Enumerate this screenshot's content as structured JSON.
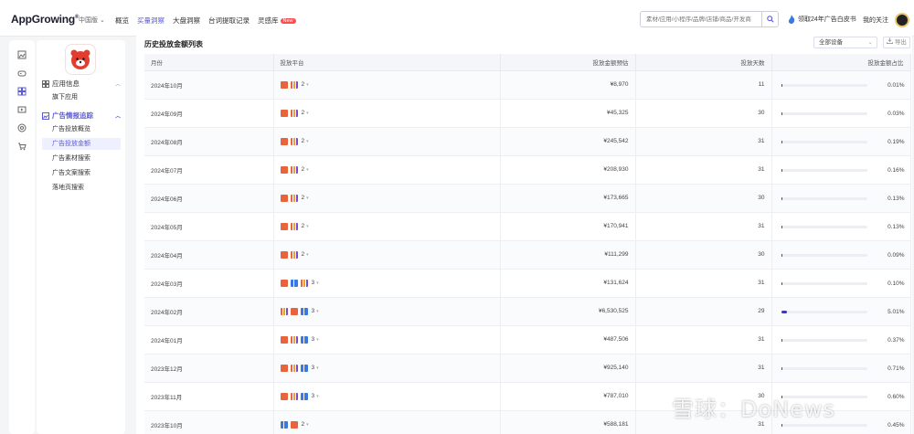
{
  "header": {
    "logo": "AppGrowing",
    "region": "中国版",
    "nav": [
      {
        "label": "概览",
        "active": false
      },
      {
        "label": "买量洞察",
        "active": true
      },
      {
        "label": "大盘洞察",
        "active": false
      },
      {
        "label": "台词提取记录",
        "active": false
      },
      {
        "label": "灵感库",
        "active": false,
        "badge": "New"
      }
    ],
    "search_placeholder": "素材/应用/小程序/品牌/店铺/商品/开发商",
    "promo": "领取24年广告白皮书",
    "follow": "我的关注"
  },
  "sidebar": {
    "section1": "应用信息",
    "section1_items": [
      "旗下应用"
    ],
    "section2": "广告情报追踪",
    "section2_items": [
      {
        "label": "广告投放概览",
        "active": false
      },
      {
        "label": "广告投放金额",
        "active": true
      },
      {
        "label": "广告素材搜索",
        "active": false
      },
      {
        "label": "广告文案搜索",
        "active": false
      },
      {
        "label": "落地页搜索",
        "active": false
      }
    ]
  },
  "main": {
    "title": "历史投放金额列表",
    "filter": "全部设备",
    "export": "导出",
    "columns": [
      "月份",
      "投放平台",
      "投放金额预估",
      "投放天数",
      "投放金额占比"
    ],
    "rows": [
      {
        "month": "2024年10月",
        "icons": [
          "toutiao",
          "multi"
        ],
        "platforms": "2",
        "amount": "¥8,970",
        "days": "11",
        "share": "0.01%",
        "share_pct": 0.01
      },
      {
        "month": "2024年09月",
        "icons": [
          "toutiao",
          "multi"
        ],
        "platforms": "2",
        "amount": "¥45,325",
        "days": "30",
        "share": "0.03%",
        "share_pct": 0.03
      },
      {
        "month": "2024年08月",
        "icons": [
          "toutiao",
          "multi"
        ],
        "platforms": "2",
        "amount": "¥245,542",
        "days": "31",
        "share": "0.19%",
        "share_pct": 0.19
      },
      {
        "month": "2024年07月",
        "icons": [
          "toutiao",
          "multi"
        ],
        "platforms": "2",
        "amount": "¥208,930",
        "days": "31",
        "share": "0.16%",
        "share_pct": 0.16
      },
      {
        "month": "2024年06月",
        "icons": [
          "toutiao",
          "multi"
        ],
        "platforms": "2",
        "amount": "¥173,665",
        "days": "30",
        "share": "0.13%",
        "share_pct": 0.13
      },
      {
        "month": "2024年05月",
        "icons": [
          "toutiao",
          "multi"
        ],
        "platforms": "2",
        "amount": "¥170,941",
        "days": "31",
        "share": "0.13%",
        "share_pct": 0.13
      },
      {
        "month": "2024年04月",
        "icons": [
          "toutiao",
          "multi"
        ],
        "platforms": "2",
        "amount": "¥111,299",
        "days": "30",
        "share": "0.09%",
        "share_pct": 0.09
      },
      {
        "month": "2024年03月",
        "icons": [
          "toutiao",
          "blue",
          "multi"
        ],
        "platforms": "3",
        "amount": "¥131,624",
        "days": "31",
        "share": "0.10%",
        "share_pct": 0.1
      },
      {
        "month": "2024年02月",
        "icons": [
          "multi",
          "toutiao",
          "blue"
        ],
        "platforms": "3",
        "amount": "¥6,530,525",
        "days": "29",
        "share": "5.01%",
        "share_pct": 5.01
      },
      {
        "month": "2024年01月",
        "icons": [
          "toutiao",
          "multi",
          "blue"
        ],
        "platforms": "3",
        "amount": "¥487,506",
        "days": "31",
        "share": "0.37%",
        "share_pct": 0.37
      },
      {
        "month": "2023年12月",
        "icons": [
          "toutiao",
          "multi",
          "blue"
        ],
        "platforms": "3",
        "amount": "¥925,140",
        "days": "31",
        "share": "0.71%",
        "share_pct": 0.71
      },
      {
        "month": "2023年11月",
        "icons": [
          "toutiao",
          "multi",
          "blue"
        ],
        "platforms": "3",
        "amount": "¥787,010",
        "days": "30",
        "share": "0.60%",
        "share_pct": 0.6
      },
      {
        "month": "2023年10月",
        "icons": [
          "blue",
          "toutiao"
        ],
        "platforms": "2",
        "amount": "¥588,181",
        "days": "31",
        "share": "0.45%",
        "share_pct": 0.45
      }
    ]
  },
  "watermark": "雪球：DoNews",
  "colors": {
    "accent": "#5b5bd6",
    "bar": "#3b3bb8",
    "new_badge": "#ff4d4f",
    "toutiao": "#e8643c"
  }
}
